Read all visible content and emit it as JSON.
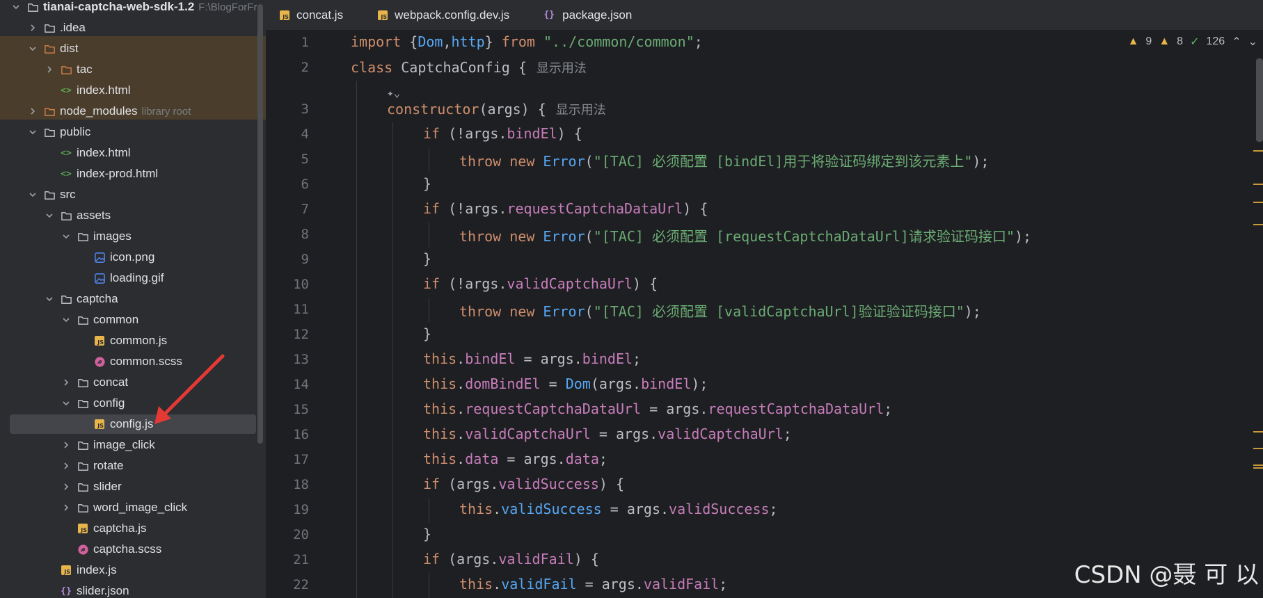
{
  "project_tree": {
    "root": {
      "label": "tianai-captcha-web-sdk-1.2",
      "path_hint": "F:\\BlogForFro"
    },
    "items": [
      {
        "label": ".idea",
        "type": "folder",
        "depth": 1,
        "expanded": false
      },
      {
        "label": "dist",
        "type": "folder",
        "depth": 1,
        "expanded": true,
        "excluded": true
      },
      {
        "label": "tac",
        "type": "folder",
        "depth": 2,
        "expanded": false,
        "excluded": true
      },
      {
        "label": "index.html",
        "type": "html",
        "depth": 2
      },
      {
        "label": "node_modules",
        "hint": "library root",
        "type": "folder",
        "depth": 1,
        "expanded": false,
        "excluded": true
      },
      {
        "label": "public",
        "type": "folder",
        "depth": 1,
        "expanded": true
      },
      {
        "label": "index.html",
        "type": "html",
        "depth": 2
      },
      {
        "label": "index-prod.html",
        "type": "html",
        "depth": 2
      },
      {
        "label": "src",
        "type": "folder",
        "depth": 1,
        "expanded": true
      },
      {
        "label": "assets",
        "type": "folder",
        "depth": 2,
        "expanded": true
      },
      {
        "label": "images",
        "type": "folder",
        "depth": 3,
        "expanded": true
      },
      {
        "label": "icon.png",
        "type": "image",
        "depth": 4
      },
      {
        "label": "loading.gif",
        "type": "image",
        "depth": 4
      },
      {
        "label": "captcha",
        "type": "folder",
        "depth": 2,
        "expanded": true
      },
      {
        "label": "common",
        "type": "folder",
        "depth": 3,
        "expanded": true
      },
      {
        "label": "common.js",
        "type": "js",
        "depth": 4
      },
      {
        "label": "common.scss",
        "type": "scss",
        "depth": 4
      },
      {
        "label": "concat",
        "type": "folder",
        "depth": 3,
        "expanded": false
      },
      {
        "label": "config",
        "type": "folder",
        "depth": 3,
        "expanded": true
      },
      {
        "label": "config.js",
        "type": "js",
        "depth": 4,
        "selected": true
      },
      {
        "label": "image_click",
        "type": "folder",
        "depth": 3,
        "expanded": false
      },
      {
        "label": "rotate",
        "type": "folder",
        "depth": 3,
        "expanded": false
      },
      {
        "label": "slider",
        "type": "folder",
        "depth": 3,
        "expanded": false
      },
      {
        "label": "word_image_click",
        "type": "folder",
        "depth": 3,
        "expanded": false
      },
      {
        "label": "captcha.js",
        "type": "js",
        "depth": 3
      },
      {
        "label": "captcha.scss",
        "type": "scss",
        "depth": 3
      },
      {
        "label": "index.js",
        "type": "js",
        "depth": 2
      },
      {
        "label": "slider.json",
        "type": "json",
        "depth": 2
      }
    ]
  },
  "tabs": [
    {
      "label": "concat.js",
      "type": "js"
    },
    {
      "label": "webpack.config.dev.js",
      "type": "js"
    },
    {
      "label": "package.json",
      "type": "json"
    }
  ],
  "inspections": {
    "warnings": "9",
    "weak_warnings": "8",
    "typos": "126"
  },
  "code": {
    "lines": [
      {
        "n": "1",
        "indent": 0,
        "tokens": [
          [
            "k",
            "import"
          ],
          [
            "t",
            " {"
          ],
          [
            "f",
            "Dom"
          ],
          [
            "t",
            ","
          ],
          [
            "f",
            "http"
          ],
          [
            "t",
            "} "
          ],
          [
            "k",
            "from"
          ],
          [
            "t",
            " "
          ],
          [
            "s",
            "\"../common/common\""
          ],
          [
            "t",
            ";"
          ]
        ]
      },
      {
        "n": "2",
        "indent": 0,
        "tokens": [
          [
            "k",
            "class"
          ],
          [
            "t",
            " CaptchaConfig {"
          ]
        ],
        "inlay": "显示用法"
      },
      {
        "n": "",
        "indent": 1,
        "hint_icon": true,
        "tokens": []
      },
      {
        "n": "3",
        "indent": 1,
        "tokens": [
          [
            "k",
            "constructor"
          ],
          [
            "t",
            "(args) {"
          ]
        ],
        "inlay": "显示用法"
      },
      {
        "n": "4",
        "indent": 2,
        "tokens": [
          [
            "k",
            "if"
          ],
          [
            "t",
            " (!args."
          ],
          [
            "p",
            "bindEl"
          ],
          [
            "t",
            ") {"
          ]
        ]
      },
      {
        "n": "5",
        "indent": 3,
        "tokens": [
          [
            "k",
            "throw new"
          ],
          [
            "t",
            " "
          ],
          [
            "f",
            "Error"
          ],
          [
            "t",
            "("
          ],
          [
            "s",
            "\"[TAC] 必须配置 [bindEl]用于将验证码绑定到该元素上\""
          ],
          [
            "t",
            ");"
          ]
        ]
      },
      {
        "n": "6",
        "indent": 2,
        "tokens": [
          [
            "t",
            "}"
          ]
        ]
      },
      {
        "n": "7",
        "indent": 2,
        "tokens": [
          [
            "k",
            "if"
          ],
          [
            "t",
            " (!args."
          ],
          [
            "p",
            "requestCaptchaDataUrl"
          ],
          [
            "t",
            ") {"
          ]
        ]
      },
      {
        "n": "8",
        "indent": 3,
        "tokens": [
          [
            "k",
            "throw new"
          ],
          [
            "t",
            " "
          ],
          [
            "f",
            "Error"
          ],
          [
            "t",
            "("
          ],
          [
            "s",
            "\"[TAC] 必须配置 [requestCaptchaDataUrl]请求验证码接口\""
          ],
          [
            "t",
            ");"
          ]
        ]
      },
      {
        "n": "9",
        "indent": 2,
        "tokens": [
          [
            "t",
            "}"
          ]
        ]
      },
      {
        "n": "10",
        "indent": 2,
        "tokens": [
          [
            "k",
            "if"
          ],
          [
            "t",
            " (!args."
          ],
          [
            "p",
            "validCaptchaUrl"
          ],
          [
            "t",
            ") {"
          ]
        ]
      },
      {
        "n": "11",
        "indent": 3,
        "tokens": [
          [
            "k",
            "throw new"
          ],
          [
            "t",
            " "
          ],
          [
            "f",
            "Error"
          ],
          [
            "t",
            "("
          ],
          [
            "s",
            "\"[TAC] 必须配置 [validCaptchaUrl]验证验证码接口\""
          ],
          [
            "t",
            ");"
          ]
        ]
      },
      {
        "n": "12",
        "indent": 2,
        "tokens": [
          [
            "t",
            "}"
          ]
        ]
      },
      {
        "n": "13",
        "indent": 2,
        "tokens": [
          [
            "k",
            "this"
          ],
          [
            "t",
            "."
          ],
          [
            "p",
            "bindEl"
          ],
          [
            "t",
            " = args."
          ],
          [
            "p",
            "bindEl"
          ],
          [
            "t",
            ";"
          ]
        ]
      },
      {
        "n": "14",
        "indent": 2,
        "tokens": [
          [
            "k",
            "this"
          ],
          [
            "t",
            "."
          ],
          [
            "p",
            "domBindEl"
          ],
          [
            "t",
            " = "
          ],
          [
            "f",
            "Dom"
          ],
          [
            "t",
            "(args."
          ],
          [
            "p",
            "bindEl"
          ],
          [
            "t",
            ");"
          ]
        ]
      },
      {
        "n": "15",
        "indent": 2,
        "tokens": [
          [
            "k",
            "this"
          ],
          [
            "t",
            "."
          ],
          [
            "p",
            "requestCaptchaDataUrl"
          ],
          [
            "t",
            " = args."
          ],
          [
            "p",
            "requestCaptchaDataUrl"
          ],
          [
            "t",
            ";"
          ]
        ]
      },
      {
        "n": "16",
        "indent": 2,
        "tokens": [
          [
            "k",
            "this"
          ],
          [
            "t",
            "."
          ],
          [
            "p",
            "validCaptchaUrl"
          ],
          [
            "t",
            " = args."
          ],
          [
            "p",
            "validCaptchaUrl"
          ],
          [
            "t",
            ";"
          ]
        ]
      },
      {
        "n": "17",
        "indent": 2,
        "tokens": [
          [
            "k",
            "this"
          ],
          [
            "t",
            "."
          ],
          [
            "p",
            "data"
          ],
          [
            "t",
            " = args."
          ],
          [
            "p",
            "data"
          ],
          [
            "t",
            ";"
          ]
        ]
      },
      {
        "n": "18",
        "indent": 2,
        "tokens": [
          [
            "k",
            "if"
          ],
          [
            "t",
            " (args."
          ],
          [
            "p",
            "validSuccess"
          ],
          [
            "t",
            ") {"
          ]
        ]
      },
      {
        "n": "19",
        "indent": 3,
        "tokens": [
          [
            "k",
            "this"
          ],
          [
            "t",
            "."
          ],
          [
            "f",
            "validSuccess"
          ],
          [
            "t",
            " = args."
          ],
          [
            "p",
            "validSuccess"
          ],
          [
            "t",
            ";"
          ]
        ]
      },
      {
        "n": "20",
        "indent": 2,
        "tokens": [
          [
            "t",
            "}"
          ]
        ]
      },
      {
        "n": "21",
        "indent": 2,
        "tokens": [
          [
            "k",
            "if"
          ],
          [
            "t",
            " (args."
          ],
          [
            "p",
            "validFail"
          ],
          [
            "t",
            ") {"
          ]
        ]
      },
      {
        "n": "22",
        "indent": 3,
        "tokens": [
          [
            "k",
            "this"
          ],
          [
            "t",
            "."
          ],
          [
            "f",
            "validFail"
          ],
          [
            "t",
            " = args."
          ],
          [
            "p",
            "validFail"
          ],
          [
            "t",
            ";"
          ]
        ]
      }
    ]
  },
  "watermark": "CSDN @聂 可 以",
  "colors": {
    "keyword": "#cf8e6d",
    "string": "#6aab73",
    "function": "#56a8f5",
    "property": "#c77dbb",
    "excluded_band": "#4a3d2b",
    "annotation_arrow": "#e53935"
  }
}
